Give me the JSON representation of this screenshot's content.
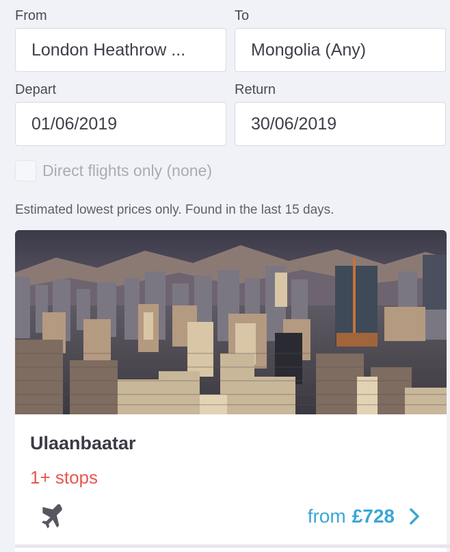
{
  "form": {
    "from_label": "From",
    "from_value": "London Heathrow ...",
    "to_label": "To",
    "to_value": "Mongolia (Any)",
    "depart_label": "Depart",
    "depart_value": "01/06/2019",
    "return_label": "Return",
    "return_value": "30/06/2019",
    "direct_label": "Direct flights only (none)",
    "direct_checked": false
  },
  "notice": "Estimated lowest prices only. Found in the last 15 days.",
  "result": {
    "city": "Ulaanbaatar",
    "stops": "1+ stops",
    "price_prefix": "from",
    "price": "£728",
    "icon": "plane-icon"
  },
  "colors": {
    "background": "#f1f2f7",
    "stops": "#e8574c",
    "price": "#3aa6d6"
  }
}
